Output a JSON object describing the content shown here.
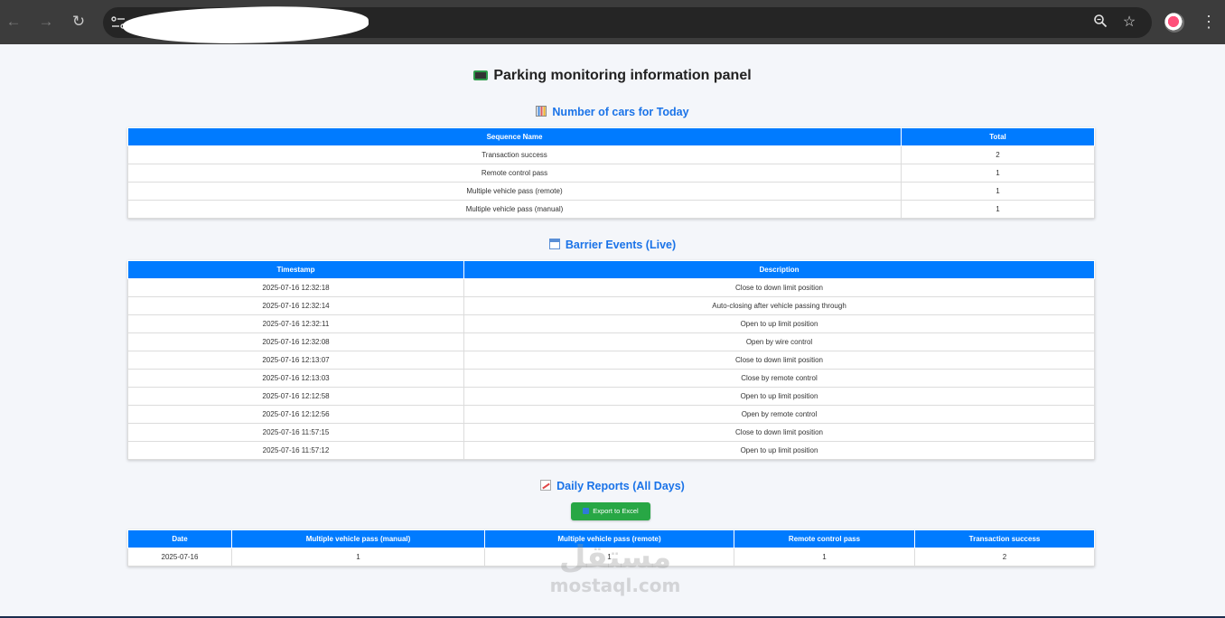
{
  "browser": {
    "icons": {
      "back": "arrow-left-icon",
      "forward": "arrow-right-icon",
      "reload": "reload-icon",
      "site_info": "tune-icon",
      "zoom": "zoom-icon",
      "bookmark": "star-icon",
      "menu": "kebab-menu-icon"
    }
  },
  "page": {
    "title": "Parking monitoring information panel",
    "title_icon": "terminal-emoji-icon"
  },
  "summary": {
    "title": "Number of cars for Today",
    "icon": "bar-chart-emoji-icon",
    "headers": [
      "Sequence Name",
      "Total"
    ],
    "rows": [
      [
        "Transaction success",
        "2"
      ],
      [
        "Remote control pass",
        "1"
      ],
      [
        "Multiple vehicle pass (remote)",
        "1"
      ],
      [
        "Multiple vehicle pass (manual)",
        "1"
      ]
    ]
  },
  "events": {
    "title": "Barrier Events (Live)",
    "icon": "calendar-emoji-icon",
    "headers": [
      "Timestamp",
      "Description"
    ],
    "rows": [
      [
        "2025-07-16 12:32:18",
        "Close to down limit position"
      ],
      [
        "2025-07-16 12:32:14",
        "Auto-closing after vehicle passing through"
      ],
      [
        "2025-07-16 12:32:11",
        "Open to up limit position"
      ],
      [
        "2025-07-16 12:32:08",
        "Open by wire control"
      ],
      [
        "2025-07-16 12:13:07",
        "Close to down limit position"
      ],
      [
        "2025-07-16 12:13:03",
        "Close by remote control"
      ],
      [
        "2025-07-16 12:12:58",
        "Open to up limit position"
      ],
      [
        "2025-07-16 12:12:56",
        "Open by remote control"
      ],
      [
        "2025-07-16 11:57:15",
        "Close to down limit position"
      ],
      [
        "2025-07-16 11:57:12",
        "Open to up limit position"
      ]
    ]
  },
  "daily": {
    "title": "Daily Reports (All Days)",
    "icon": "chart-increasing-emoji-icon",
    "export_label": "Export to Excel",
    "export_icon": "download-emoji-icon",
    "headers": [
      "Date",
      "Multiple vehicle pass (manual)",
      "Multiple vehicle pass (remote)",
      "Remote control pass",
      "Transaction success"
    ],
    "rows": [
      [
        "2025-07-16",
        "1",
        "1",
        "1",
        "2"
      ]
    ]
  },
  "watermark": {
    "arabic": "مستقل",
    "latin": "mostaql.com"
  },
  "colors": {
    "accent": "#007bff",
    "title_blue": "#1a73e8",
    "export_green": "#28a745",
    "browser_chrome": "#3c3c3c"
  }
}
